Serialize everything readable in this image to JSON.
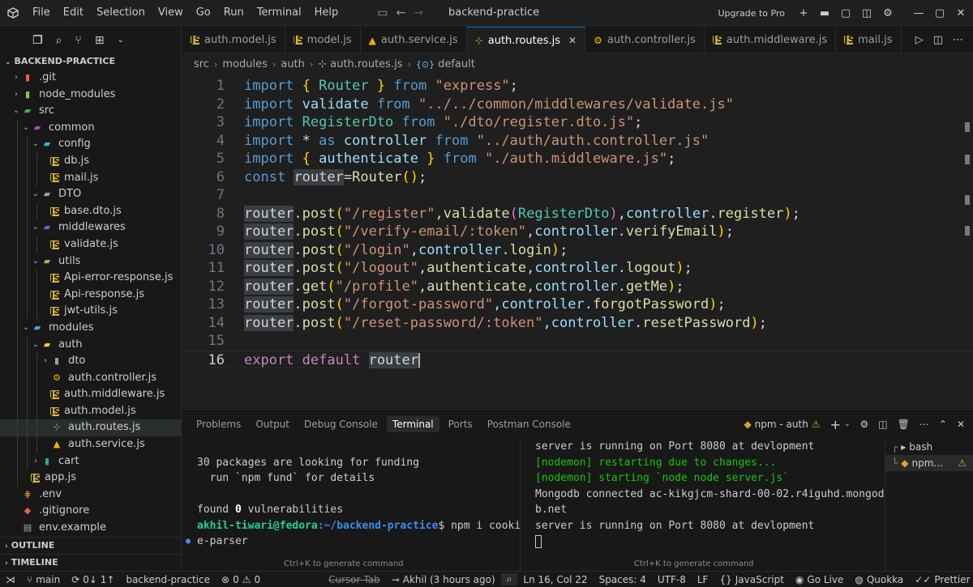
{
  "titlebar": {
    "menu": [
      "File",
      "Edit",
      "Selection",
      "View",
      "Go",
      "Run",
      "Terminal",
      "Help"
    ],
    "title": "backend-practice",
    "upgrade": "Upgrade to Pro"
  },
  "sidebar": {
    "header": "BACKEND-PRACTICE",
    "items": [
      {
        "label": ".git",
        "depth": 0,
        "type": "folder",
        "open": false,
        "icon_color": "#e8643a"
      },
      {
        "label": "node_modules",
        "depth": 0,
        "type": "folder",
        "open": false,
        "icon_color": "#8bc34a"
      },
      {
        "label": "src",
        "depth": 0,
        "type": "folder",
        "open": true,
        "icon_color": "#4caf50"
      },
      {
        "label": "common",
        "depth": 1,
        "type": "folder",
        "open": true,
        "icon_color": "#ab47bc"
      },
      {
        "label": "config",
        "depth": 2,
        "type": "folder",
        "open": true,
        "icon_color": "#26c6da"
      },
      {
        "label": "db.js",
        "depth": 3,
        "type": "js"
      },
      {
        "label": "mail.js",
        "depth": 3,
        "type": "js"
      },
      {
        "label": "DTO",
        "depth": 2,
        "type": "folder",
        "open": true,
        "icon_color": "#90a4ae"
      },
      {
        "label": "base.dto.js",
        "depth": 3,
        "type": "js"
      },
      {
        "label": "middlewares",
        "depth": 2,
        "type": "folder",
        "open": true,
        "icon_color": "#7e57c2"
      },
      {
        "label": "validate.js",
        "depth": 3,
        "type": "js"
      },
      {
        "label": "utils",
        "depth": 2,
        "type": "folder",
        "open": true,
        "icon_color": "#8bc34a"
      },
      {
        "label": "Api-error-response.js",
        "depth": 3,
        "type": "js"
      },
      {
        "label": "Api-response.js",
        "depth": 3,
        "type": "js"
      },
      {
        "label": "jwt-utils.js",
        "depth": 3,
        "type": "js"
      },
      {
        "label": "modules",
        "depth": 1,
        "type": "folder",
        "open": true,
        "icon_color": "#42a5f5"
      },
      {
        "label": "auth",
        "depth": 2,
        "type": "folder",
        "open": true,
        "icon_color": "#ffca28"
      },
      {
        "label": "dto",
        "depth": 3,
        "type": "folder",
        "open": false,
        "icon_color": "#90a4ae"
      },
      {
        "label": "auth.controller.js",
        "depth": 3,
        "type": "gear"
      },
      {
        "label": "auth.middleware.js",
        "depth": 3,
        "type": "js"
      },
      {
        "label": "auth.model.js",
        "depth": 3,
        "type": "js"
      },
      {
        "label": "auth.routes.js",
        "depth": 3,
        "type": "routes",
        "selected": true
      },
      {
        "label": "auth.service.js",
        "depth": 3,
        "type": "service"
      },
      {
        "label": "cart",
        "depth": 2,
        "type": "folder",
        "open": false,
        "icon_color": "#26a69a"
      },
      {
        "label": "app.js",
        "depth": 1,
        "type": "js"
      },
      {
        "label": ".env",
        "depth": 0,
        "type": "env"
      },
      {
        "label": ".gitignore",
        "depth": 0,
        "type": "git"
      },
      {
        "label": "env.example",
        "depth": 0,
        "type": "file"
      }
    ],
    "outline": "OUTLINE",
    "timeline": "TIMELINE"
  },
  "tabs": [
    {
      "label": "auth.model.js",
      "icon": "js",
      "active": false
    },
    {
      "label": "model.js",
      "icon": "js",
      "active": false
    },
    {
      "label": "auth.service.js",
      "icon": "service",
      "active": false
    },
    {
      "label": "auth.routes.js",
      "icon": "routes",
      "active": true
    },
    {
      "label": "auth.controller.js",
      "icon": "gear",
      "active": false
    },
    {
      "label": "auth.middleware.js",
      "icon": "js",
      "active": false
    },
    {
      "label": "mail.js",
      "icon": "js",
      "active": false
    }
  ],
  "breadcrumb": [
    "src",
    "modules",
    "auth",
    "auth.routes.js",
    "default"
  ],
  "editor": {
    "lines": [
      {
        "n": "1",
        "tokens": [
          [
            "k",
            "import"
          ],
          [
            "t",
            " "
          ],
          [
            "b1",
            "{"
          ],
          [
            "t",
            " "
          ],
          [
            "c",
            "Router"
          ],
          [
            "t",
            " "
          ],
          [
            "b1",
            "}"
          ],
          [
            "t",
            " "
          ],
          [
            "k",
            "from"
          ],
          [
            "t",
            " "
          ],
          [
            "s",
            "\"express\""
          ],
          [
            "t",
            ";"
          ]
        ]
      },
      {
        "n": "2",
        "tokens": [
          [
            "k",
            "import"
          ],
          [
            "t",
            " "
          ],
          [
            "v",
            "validate"
          ],
          [
            "t",
            " "
          ],
          [
            "k",
            "from"
          ],
          [
            "t",
            " "
          ],
          [
            "s",
            "\"../../common/middlewares/validate.js\""
          ]
        ]
      },
      {
        "n": "3",
        "tokens": [
          [
            "k",
            "import"
          ],
          [
            "t",
            " "
          ],
          [
            "c",
            "RegisterDto"
          ],
          [
            "t",
            " "
          ],
          [
            "k",
            "from"
          ],
          [
            "t",
            " "
          ],
          [
            "s",
            "\"./dto/register.dto.js\""
          ],
          [
            "t",
            ";"
          ]
        ]
      },
      {
        "n": "4",
        "tokens": [
          [
            "k",
            "import"
          ],
          [
            "t",
            " * "
          ],
          [
            "k",
            "as"
          ],
          [
            "t",
            " "
          ],
          [
            "v",
            "controller"
          ],
          [
            "t",
            " "
          ],
          [
            "k",
            "from"
          ],
          [
            "t",
            " "
          ],
          [
            "s",
            "\"../auth/auth.controller.js\""
          ]
        ]
      },
      {
        "n": "5",
        "tokens": [
          [
            "k",
            "import"
          ],
          [
            "t",
            " "
          ],
          [
            "b1",
            "{"
          ],
          [
            "t",
            " "
          ],
          [
            "v",
            "authenticate"
          ],
          [
            "t",
            " "
          ],
          [
            "b1",
            "}"
          ],
          [
            "t",
            " "
          ],
          [
            "k",
            "from"
          ],
          [
            "t",
            " "
          ],
          [
            "s",
            "\"./auth.middleware.js\""
          ],
          [
            "t",
            ";"
          ]
        ]
      },
      {
        "n": "6",
        "tokens": [
          [
            "k",
            "const"
          ],
          [
            "t",
            " "
          ],
          [
            "hl",
            "router"
          ],
          [
            "t",
            "="
          ],
          [
            "f",
            "Router"
          ],
          [
            "b1",
            "()"
          ],
          [
            "t",
            ";"
          ]
        ]
      },
      {
        "n": "7",
        "tokens": []
      },
      {
        "n": "8",
        "tokens": [
          [
            "hl",
            "router"
          ],
          [
            "t",
            "."
          ],
          [
            "f",
            "post"
          ],
          [
            "b1",
            "("
          ],
          [
            "s",
            "\"/register\""
          ],
          [
            "t",
            ","
          ],
          [
            "f",
            "validate"
          ],
          [
            "b2",
            "("
          ],
          [
            "c",
            "RegisterDto"
          ],
          [
            "b2",
            ")"
          ],
          [
            "t",
            ","
          ],
          [
            "v",
            "controller"
          ],
          [
            "t",
            "."
          ],
          [
            "f",
            "register"
          ],
          [
            "b1",
            ")"
          ],
          [
            "t",
            ";"
          ]
        ]
      },
      {
        "n": "9",
        "tokens": [
          [
            "hl",
            "router"
          ],
          [
            "t",
            "."
          ],
          [
            "f",
            "post"
          ],
          [
            "b1",
            "("
          ],
          [
            "s",
            "\"/verify-email/:token\""
          ],
          [
            "t",
            ","
          ],
          [
            "v",
            "controller"
          ],
          [
            "t",
            "."
          ],
          [
            "f",
            "verifyEmail"
          ],
          [
            "b1",
            ")"
          ],
          [
            "t",
            ";"
          ]
        ]
      },
      {
        "n": "10",
        "tokens": [
          [
            "hl",
            "router"
          ],
          [
            "t",
            "."
          ],
          [
            "f",
            "post"
          ],
          [
            "b1",
            "("
          ],
          [
            "s",
            "\"/login\""
          ],
          [
            "t",
            ","
          ],
          [
            "v",
            "controller"
          ],
          [
            "t",
            "."
          ],
          [
            "f",
            "login"
          ],
          [
            "b1",
            ")"
          ],
          [
            "t",
            ";"
          ]
        ]
      },
      {
        "n": "11",
        "tokens": [
          [
            "hl",
            "router"
          ],
          [
            "t",
            "."
          ],
          [
            "f",
            "post"
          ],
          [
            "b1",
            "("
          ],
          [
            "s",
            "\"/logout\""
          ],
          [
            "t",
            ","
          ],
          [
            "f",
            "authenticate"
          ],
          [
            "t",
            ","
          ],
          [
            "v",
            "controller"
          ],
          [
            "t",
            "."
          ],
          [
            "f",
            "logout"
          ],
          [
            "b1",
            ")"
          ],
          [
            "t",
            ";"
          ]
        ]
      },
      {
        "n": "12",
        "tokens": [
          [
            "hl",
            "router"
          ],
          [
            "t",
            "."
          ],
          [
            "f",
            "get"
          ],
          [
            "b1",
            "("
          ],
          [
            "s",
            "\"/profile\""
          ],
          [
            "t",
            ","
          ],
          [
            "f",
            "authenticate"
          ],
          [
            "t",
            ","
          ],
          [
            "v",
            "controller"
          ],
          [
            "t",
            "."
          ],
          [
            "f",
            "getMe"
          ],
          [
            "b1",
            ")"
          ],
          [
            "t",
            ";"
          ]
        ]
      },
      {
        "n": "13",
        "tokens": [
          [
            "hl",
            "router"
          ],
          [
            "t",
            "."
          ],
          [
            "f",
            "post"
          ],
          [
            "b1",
            "("
          ],
          [
            "s",
            "\"/forgot-password\""
          ],
          [
            "t",
            ","
          ],
          [
            "v",
            "controller"
          ],
          [
            "t",
            "."
          ],
          [
            "f",
            "forgotPassword"
          ],
          [
            "b1",
            ")"
          ],
          [
            "t",
            ";"
          ]
        ]
      },
      {
        "n": "14",
        "tokens": [
          [
            "hl",
            "router"
          ],
          [
            "t",
            "."
          ],
          [
            "f",
            "post"
          ],
          [
            "b1",
            "("
          ],
          [
            "s",
            "\"/reset-password/:token\""
          ],
          [
            "t",
            ","
          ],
          [
            "v",
            "controller"
          ],
          [
            "t",
            "."
          ],
          [
            "f",
            "resetPassword"
          ],
          [
            "b1",
            ")"
          ],
          [
            "t",
            ";"
          ]
        ]
      },
      {
        "n": "15",
        "tokens": []
      },
      {
        "n": "16",
        "tokens": [
          [
            "kk",
            "export"
          ],
          [
            "t",
            " "
          ],
          [
            "kk",
            "default"
          ],
          [
            "t",
            " "
          ],
          [
            "hl",
            "router"
          ]
        ],
        "current": true
      }
    ]
  },
  "panel": {
    "tabs": [
      "Problems",
      "Output",
      "Debug Console",
      "Terminal",
      "Ports",
      "Postman Console"
    ],
    "active_tab": "Terminal",
    "terminal_name": "npm - auth",
    "term1": {
      "lines": [
        {
          "text": ""
        },
        {
          "text": "30 packages are looking for funding"
        },
        {
          "text": "  run `npm fund` for details"
        },
        {
          "text": ""
        },
        {
          "prefix": "found ",
          "num": "0",
          "suffix": " vulnerabilities"
        },
        {
          "user": "akhil-tiwari@fedora",
          "path": ":~/backend-practice",
          "cmd": "$ npm i cooki"
        },
        {
          "text": "e-parser",
          "dot": true
        }
      ],
      "hint": "Ctrl+K to generate command"
    },
    "term2": {
      "lines": [
        {
          "text": "server is running on Port 8080 at devlopment",
          "cls": ""
        },
        {
          "text": "[nodemon] restarting due to changes...",
          "cls": "green"
        },
        {
          "text": "[nodemon] starting `node node server.js`",
          "cls": "green"
        },
        {
          "text": "Mongodb connected ac-kikgjcm-shard-00-02.r4iguhd.mongod",
          "cls": ""
        },
        {
          "text": "b.net",
          "cls": ""
        },
        {
          "text": "server is running on Port 8080 at devlopment",
          "cls": ""
        }
      ],
      "hint": "Ctrl+K to generate command"
    },
    "terminals": [
      {
        "label": "bash",
        "active": false
      },
      {
        "label": "npm...",
        "active": true,
        "warn": true
      }
    ]
  },
  "statusbar": {
    "branch": "main",
    "sync": "0↓ 1↑",
    "project": "backend-practice",
    "errors": "0",
    "warnings": "0",
    "cursor_tab": "Cursor Tab",
    "blame": "Akhil (3 hours ago)",
    "position": "Ln 16, Col 22",
    "spaces": "Spaces: 4",
    "encoding": "UTF-8",
    "eol": "LF",
    "language": "JavaScript",
    "golive": "Go Live",
    "quokka": "Quokka",
    "prettier": "Prettier"
  }
}
